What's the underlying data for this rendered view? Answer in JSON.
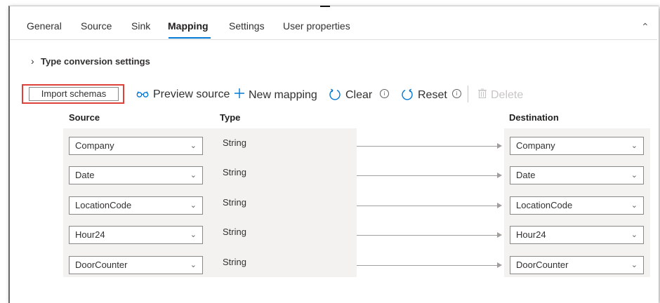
{
  "tabs": [
    {
      "label": "General"
    },
    {
      "label": "Source"
    },
    {
      "label": "Sink"
    },
    {
      "label": "Mapping",
      "active": true
    },
    {
      "label": "Settings"
    },
    {
      "label": "User properties"
    }
  ],
  "collapse_icon": "chevron-up-icon",
  "type_conversion": {
    "label": "Type conversion settings"
  },
  "toolbar": {
    "import_label": "Import schemas",
    "preview_label": "Preview source",
    "new_mapping_label": "New mapping",
    "clear_label": "Clear",
    "reset_label": "Reset",
    "delete_label": "Delete"
  },
  "headers": {
    "source": "Source",
    "type": "Type",
    "destination": "Destination"
  },
  "mappings": [
    {
      "source": "Company",
      "type": "String",
      "destination": "Company"
    },
    {
      "source": "Date",
      "type": "String",
      "destination": "Date"
    },
    {
      "source": "LocationCode",
      "type": "String",
      "destination": "LocationCode"
    },
    {
      "source": "Hour24",
      "type": "String",
      "destination": "Hour24"
    },
    {
      "source": "DoorCounter",
      "type": "String",
      "destination": "DoorCounter"
    }
  ],
  "colors": {
    "accent": "#0078d4",
    "highlight": "#e0403a"
  }
}
